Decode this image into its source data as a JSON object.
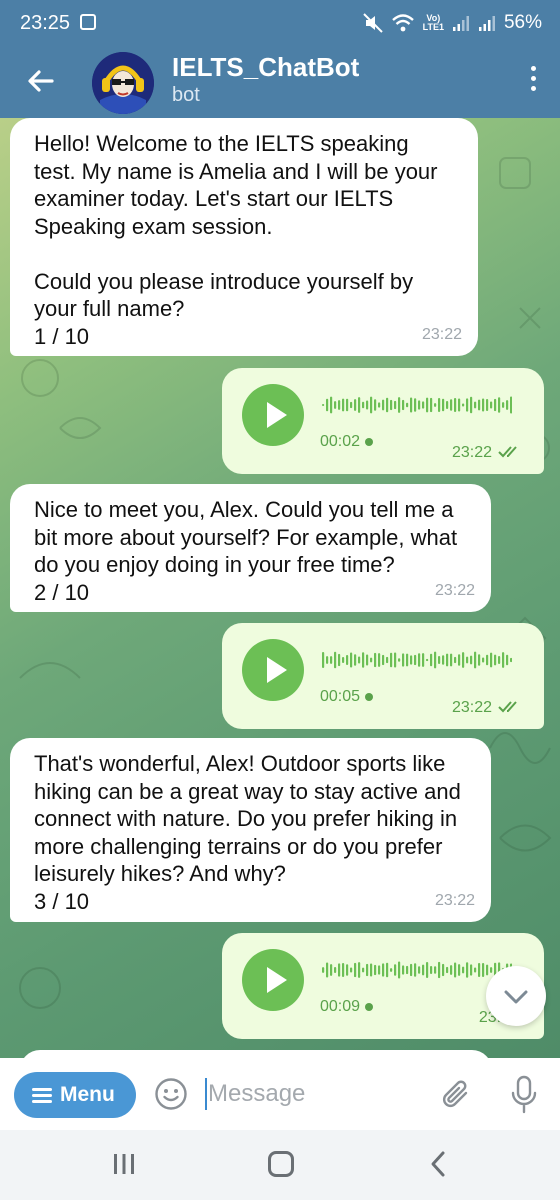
{
  "status_bar": {
    "time": "23:25",
    "network_label_top": "Vo)",
    "network_label_bottom": "LTE1",
    "battery": "56%"
  },
  "header": {
    "title": "IELTS_ChatBot",
    "subtitle": "bot"
  },
  "messages": [
    {
      "type": "incoming",
      "text": "Hello! Welcome to the IELTS speaking test. My name is Amelia and I will be your examiner today. Let's start our IELTS Speaking exam session.\n\nCould you please introduce yourself by your full name?\n1 / 10",
      "time": "23:22"
    },
    {
      "type": "voice",
      "duration": "00:02",
      "time": "23:22",
      "status": "read"
    },
    {
      "type": "incoming",
      "text": "Nice to meet you, Alex. Could you tell me a bit more about yourself? For example, what do you enjoy doing in your free time?\n2 / 10",
      "time": "23:22"
    },
    {
      "type": "voice",
      "duration": "00:05",
      "time": "23:22",
      "status": "read"
    },
    {
      "type": "incoming",
      "text": "That's wonderful, Alex! Outdoor sports like hiking can be a great way to stay active and connect with nature. Do you prefer hiking in more challenging terrains or do you prefer leisurely hikes? And why?\n3 / 10",
      "time": "23:22"
    },
    {
      "type": "voice",
      "duration": "00:09",
      "time": "23:2",
      "status": "read"
    }
  ],
  "input_bar": {
    "menu_label": "Menu",
    "placeholder": "Message"
  },
  "colors": {
    "header": "#4c7fa6",
    "outgoing_bubble": "#effcde",
    "accent_green": "#6cbf55",
    "menu_button": "#4a97d5"
  }
}
